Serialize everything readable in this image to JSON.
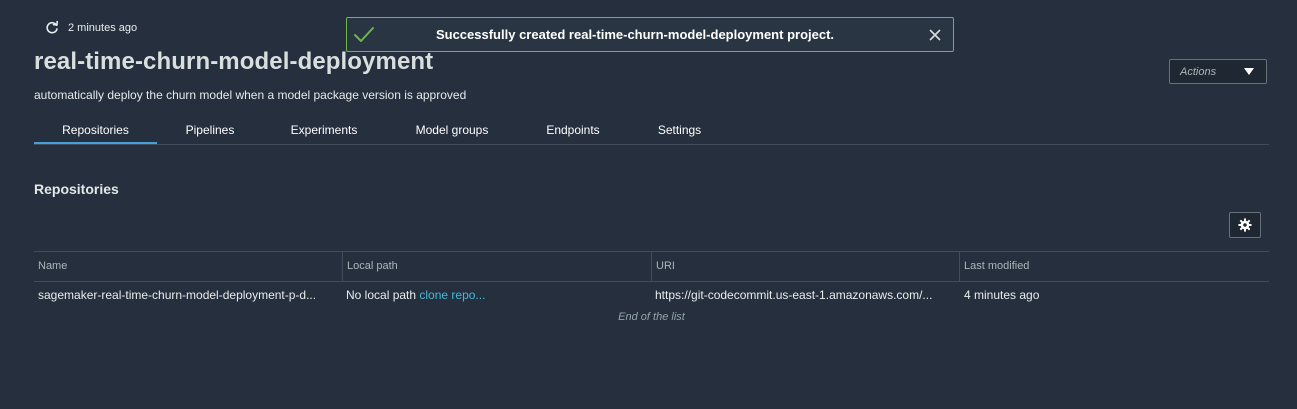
{
  "header": {
    "refresh_time": "2 minutes ago",
    "title": "real-time-churn-model-deployment",
    "description": "automatically deploy the churn model when a model package version is approved",
    "actions_label": "Actions"
  },
  "toast": {
    "message": "Successfully created real-time-churn-model-deployment project.",
    "accent_color": "#6bb84a"
  },
  "tabs": [
    {
      "label": "Repositories",
      "active": true
    },
    {
      "label": "Pipelines"
    },
    {
      "label": "Experiments"
    },
    {
      "label": "Model groups"
    },
    {
      "label": "Endpoints"
    },
    {
      "label": "Settings"
    }
  ],
  "section": {
    "title": "Repositories"
  },
  "table": {
    "columns": [
      "Name",
      "Local path",
      "URI",
      "Last modified"
    ],
    "rows": [
      {
        "name": "sagemaker-real-time-churn-model-deployment-p-d...",
        "local_path": "No local path",
        "clone_link": "clone repo...",
        "uri": "https://git-codecommit.us-east-1.amazonaws.com/...",
        "last_modified": "4 minutes ago"
      }
    ],
    "end_text": "End of the list"
  },
  "icons": {
    "refresh": "refresh-icon",
    "success": "check-icon",
    "close": "close-icon",
    "dropdown": "caret-down-icon",
    "settings": "gear-icon"
  },
  "colors": {
    "background": "#252f3d",
    "tab_active": "#44a0d9",
    "link": "#44b9d6"
  }
}
